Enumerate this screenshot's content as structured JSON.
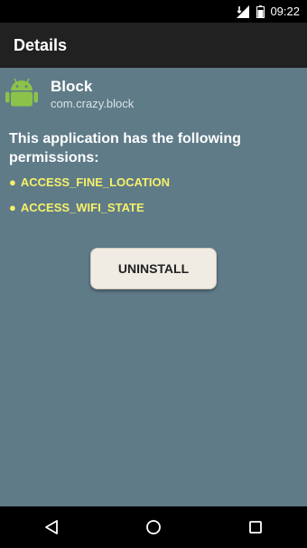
{
  "status_bar": {
    "time": "09:22",
    "icons": [
      "signal-icon",
      "battery-icon"
    ]
  },
  "action_bar": {
    "title": "Details"
  },
  "app": {
    "name": "Block",
    "package": "com.crazy.block",
    "icon": "android-robot-icon",
    "icon_color": "#8bc34a"
  },
  "permissions": {
    "heading": "This application has the following permissions:",
    "items": [
      "ACCESS_FINE_LOCATION",
      "ACCESS_WIFI_STATE"
    ],
    "item_color": "#f5f06a"
  },
  "actions": {
    "uninstall_label": "UNINSTALL"
  },
  "nav_bar": {
    "icons": [
      "back-icon",
      "home-icon",
      "recents-icon"
    ]
  },
  "colors": {
    "background": "#5f7b88",
    "action_bar": "#212121"
  }
}
